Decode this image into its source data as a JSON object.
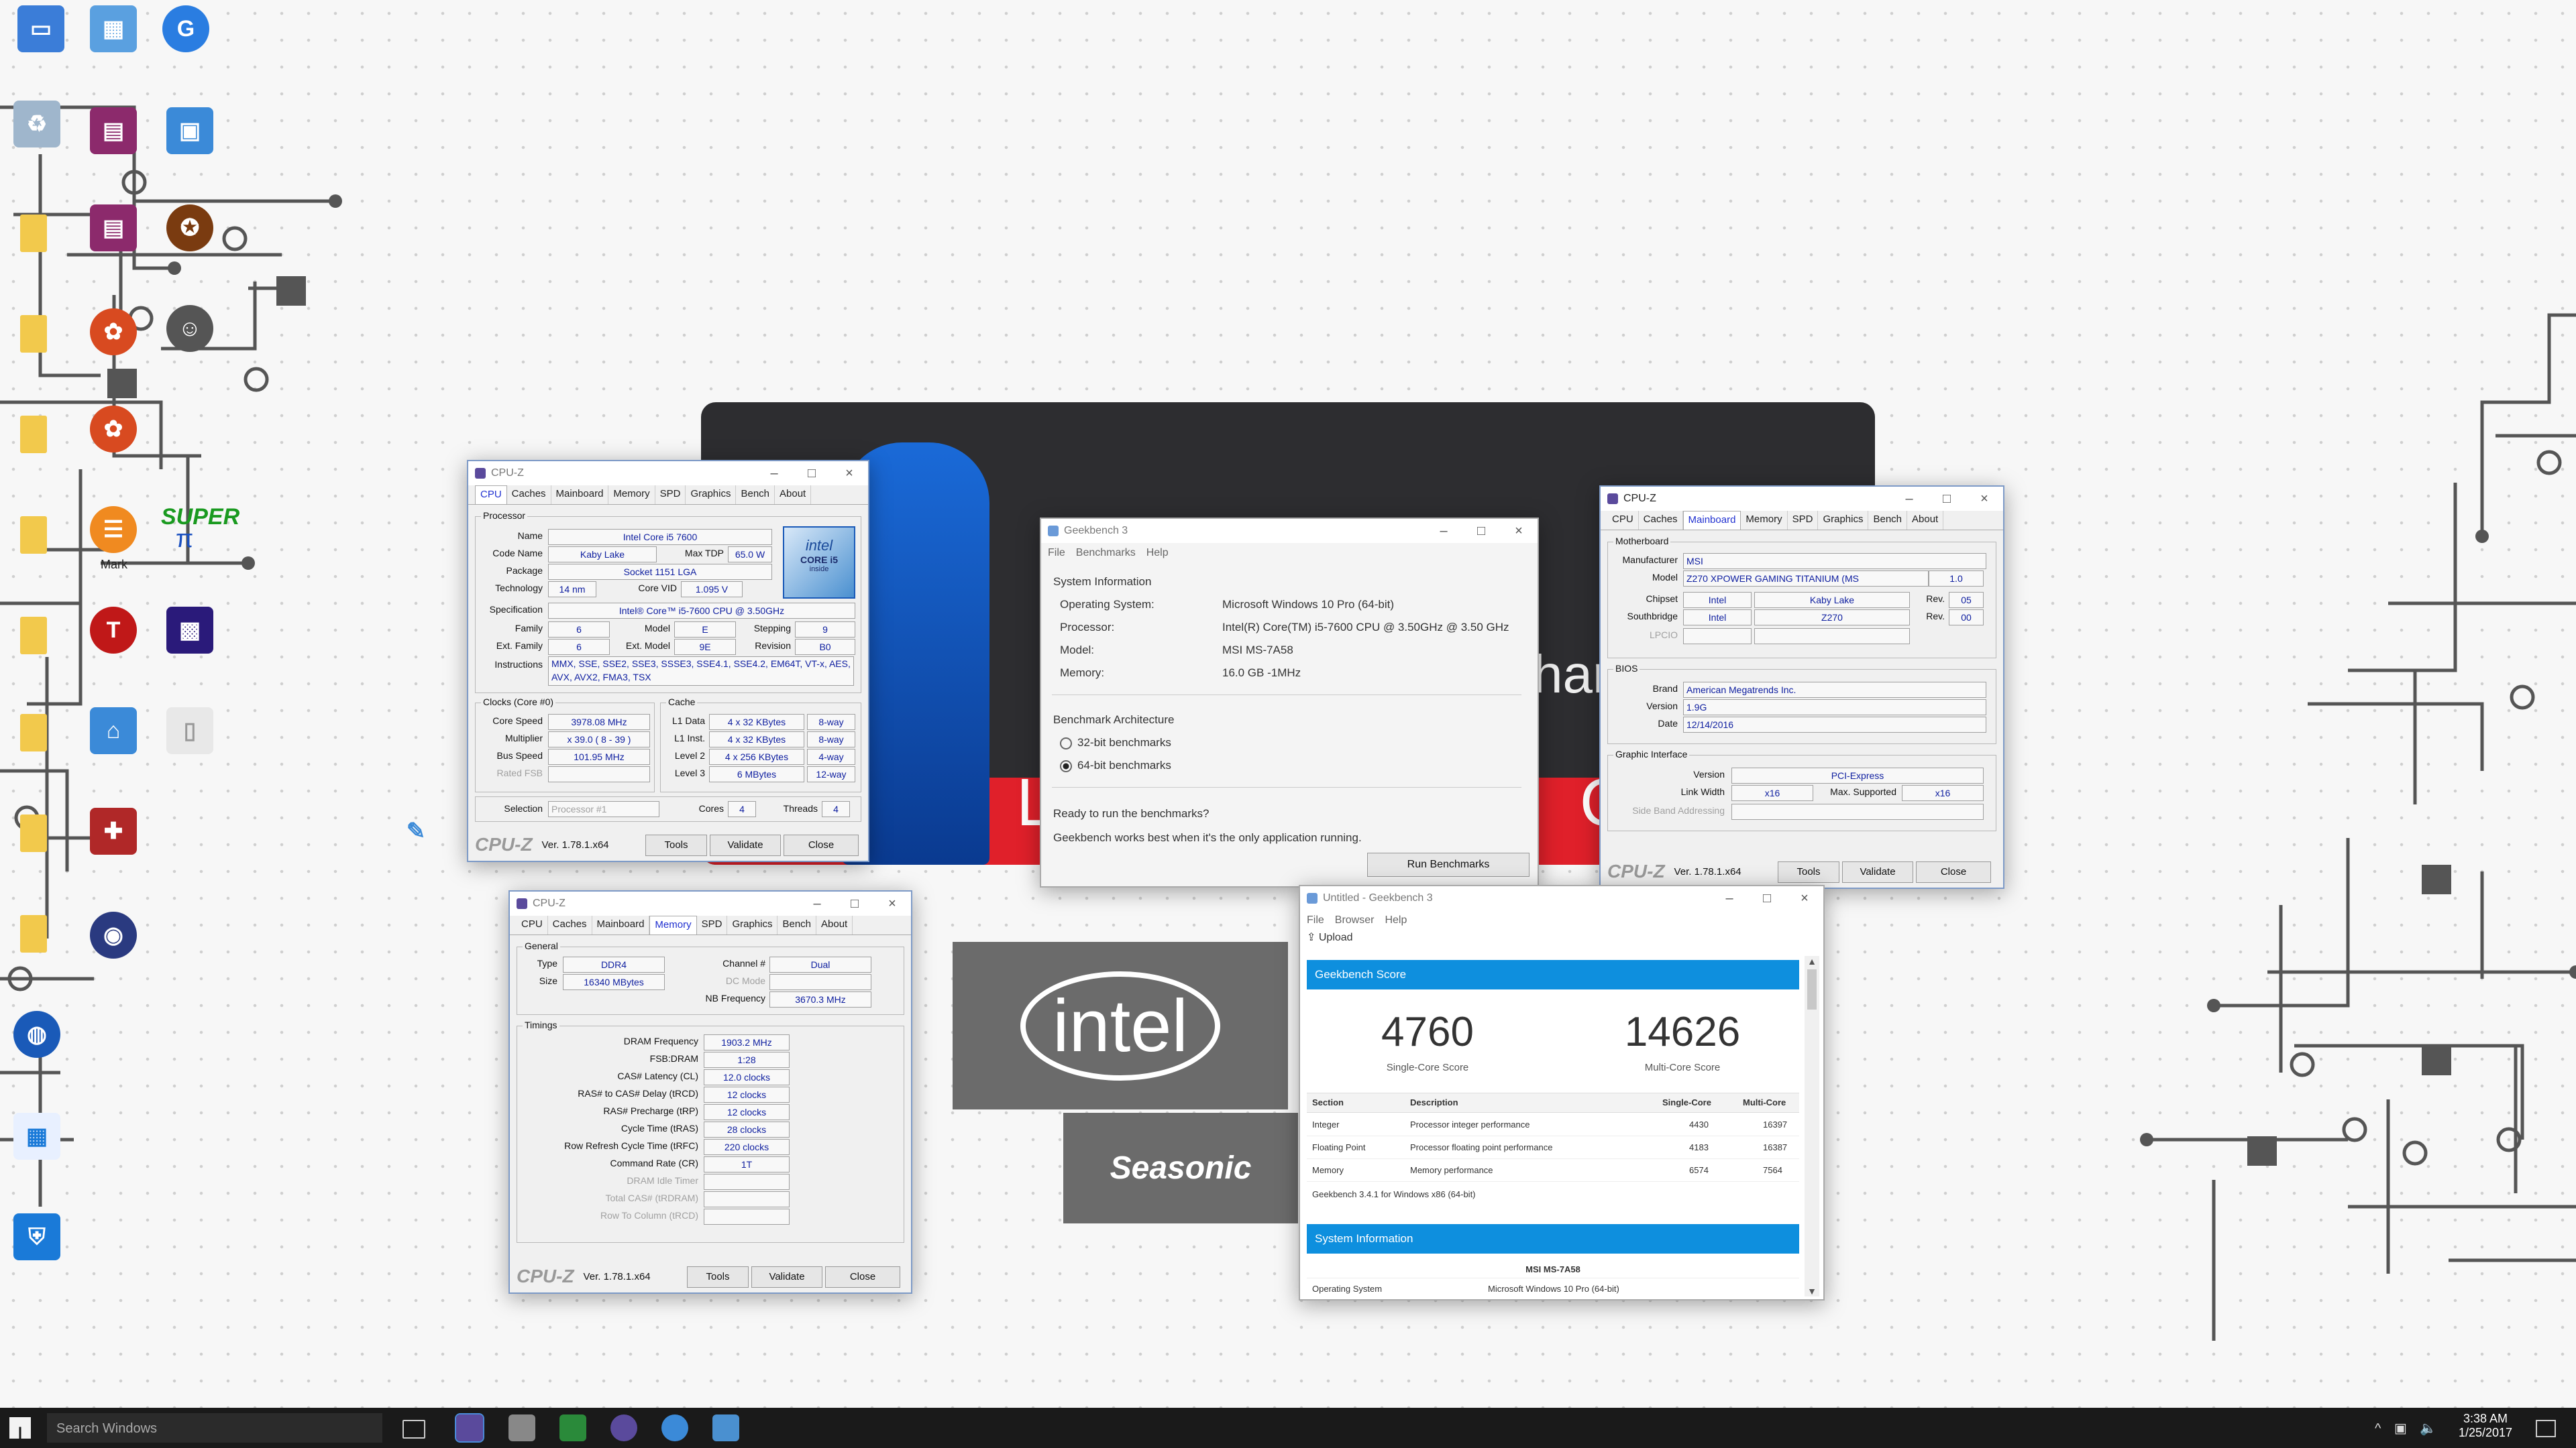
{
  "colors": {
    "accent": "#0e8fde",
    "cpuz_blue": "#2030d0",
    "banner_red": "#e0202a",
    "banner_dark": "#2d2d30"
  },
  "desktop": {
    "icons": [
      "computer-icon",
      "control-panel-icon",
      "google-chrome-icon",
      "recycle-bin-icon",
      "winrar-icon",
      "windows-update-icon",
      "game-icon",
      "super-pi-icon",
      "cinebench-icon",
      "cpu-icon",
      "intel-icon"
    ],
    "label_mark": "Mark",
    "label_super": "SUPER",
    "label_pi": "π"
  },
  "banner": {
    "letters_left": "L",
    "letters_right": "Q",
    "partial": "har"
  },
  "intel_logo": "intel",
  "seasonic_logo": "Seasonic",
  "cpuz_cpu": {
    "title": "CPU-Z",
    "tabs": [
      "CPU",
      "Caches",
      "Mainboard",
      "Memory",
      "SPD",
      "Graphics",
      "Bench",
      "About"
    ],
    "processor_group": "Processor",
    "name_label": "Name",
    "name": "Intel Core i5 7600",
    "codename_label": "Code Name",
    "codename": "Kaby Lake",
    "maxtdp_label": "Max TDP",
    "maxtdp": "65.0 W",
    "package_label": "Package",
    "package": "Socket 1151 LGA",
    "technology_label": "Technology",
    "technology": "14 nm",
    "corevid_label": "Core VID",
    "corevid": "1.095 V",
    "spec_label": "Specification",
    "spec": "Intel® Core™ i5-7600 CPU @ 3.50GHz",
    "family_label": "Family",
    "family": "6",
    "model_label": "Model",
    "model": "E",
    "stepping_label": "Stepping",
    "stepping": "9",
    "extfamily_label": "Ext. Family",
    "extfamily": "6",
    "extmodel_label": "Ext. Model",
    "extmodel": "9E",
    "revision_label": "Revision",
    "revision": "B0",
    "instr_label": "Instructions",
    "instr": "MMX, SSE, SSE2, SSE3, SSSE3, SSE4.1, SSE4.2, EM64T, VT-x, AES, AVX, AVX2, FMA3, TSX",
    "clocks_group": "Clocks (Core #0)",
    "corespeed_label": "Core Speed",
    "corespeed": "3978.08 MHz",
    "multiplier_label": "Multiplier",
    "multiplier": "x 39.0 ( 8 - 39 )",
    "busspeed_label": "Bus Speed",
    "busspeed": "101.95 MHz",
    "ratedfsb_label": "Rated FSB",
    "cache_group": "Cache",
    "l1d_label": "L1 Data",
    "l1d": "4 x 32 KBytes",
    "l1d_way": "8-way",
    "l1i_label": "L1 Inst.",
    "l1i": "4 x 32 KBytes",
    "l1i_way": "8-way",
    "l2_label": "Level 2",
    "l2": "4 x 256 KBytes",
    "l2_way": "4-way",
    "l3_label": "Level 3",
    "l3": "6 MBytes",
    "l3_way": "12-way",
    "selection_label": "Selection",
    "selection": "Processor #1",
    "cores_label": "Cores",
    "cores": "4",
    "threads_label": "Threads",
    "threads": "4",
    "intel_badge_top": "intel",
    "intel_badge_mid": "CORE i5",
    "intel_badge_bot": "inside"
  },
  "cpuz_footer": {
    "logo": "CPU-Z",
    "version": "Ver. 1.78.1.x64",
    "tools": "Tools",
    "validate": "Validate",
    "close": "Close"
  },
  "cpuz_mem": {
    "title": "CPU-Z",
    "general_group": "General",
    "type_label": "Type",
    "type": "DDR4",
    "channel_label": "Channel #",
    "channel": "Dual",
    "size_label": "Size",
    "size": "16340 MBytes",
    "dcmode_label": "DC Mode",
    "nbfreq_label": "NB Frequency",
    "nbfreq": "3670.3 MHz",
    "timings_group": "Timings",
    "dram_label": "DRAM Frequency",
    "dram": "1903.2 MHz",
    "fsb_label": "FSB:DRAM",
    "fsb": "1:28",
    "cl_label": "CAS# Latency (CL)",
    "cl": "12.0 clocks",
    "trcd_label": "RAS# to CAS# Delay (tRCD)",
    "trcd": "12 clocks",
    "trp_label": "RAS# Precharge (tRP)",
    "trp": "12 clocks",
    "tras_label": "Cycle Time (tRAS)",
    "tras": "28 clocks",
    "trfc_label": "Row Refresh Cycle Time (tRFC)",
    "trfc": "220 clocks",
    "cr_label": "Command Rate (CR)",
    "cr": "1T",
    "idle_label": "DRAM Idle Timer",
    "totalcas_label": "Total CAS# (tRDRAM)",
    "rowcol_label": "Row To Column (tRCD)"
  },
  "cpuz_mb": {
    "title": "CPU-Z",
    "motherboard_group": "Motherboard",
    "manufacturer_label": "Manufacturer",
    "manufacturer": "MSI",
    "model_label": "Model",
    "model": "Z270 XPOWER GAMING TITANIUM (MS",
    "model_rev": "1.0",
    "chipset_label": "Chipset",
    "chipset_vendor": "Intel",
    "chipset_name": "Kaby Lake",
    "chipset_rev_label": "Rev.",
    "chipset_rev": "05",
    "south_label": "Southbridge",
    "south_vendor": "Intel",
    "south_name": "Z270",
    "south_rev_label": "Rev.",
    "south_rev": "00",
    "lpcio_label": "LPCIO",
    "bios_group": "BIOS",
    "brand_label": "Brand",
    "brand": "American Megatrends Inc.",
    "version_label": "Version",
    "version": "1.9G",
    "date_label": "Date",
    "date": "12/14/2016",
    "gi_group": "Graphic Interface",
    "gi_version_label": "Version",
    "gi_version": "PCI-Express",
    "linkwidth_label": "Link Width",
    "linkwidth": "x16",
    "maxsup_label": "Max. Supported",
    "maxsup": "x16",
    "sideband_label": "Side Band Addressing"
  },
  "gb_launcher": {
    "title": "Geekbench 3",
    "menu": [
      "File",
      "Benchmarks",
      "Help"
    ],
    "sysinfo_heading": "System Information",
    "os_label": "Operating System:",
    "os": "Microsoft Windows 10 Pro (64-bit)",
    "proc_label": "Processor:",
    "proc": "Intel(R) Core(TM) i5-7600 CPU @ 3.50GHz @ 3.50 GHz",
    "model_label": "Model:",
    "model": "MSI MS-7A58",
    "mem_label": "Memory:",
    "mem": "16.0 GB -1MHz",
    "arch_heading": "Benchmark Architecture",
    "opt32": "32-bit benchmarks",
    "opt64": "64-bit benchmarks",
    "ready": "Ready to run the benchmarks?",
    "hint": "Geekbench works best when it's the only application running.",
    "run_button": "Run Benchmarks"
  },
  "gb_results": {
    "title": "Untitled - Geekbench 3",
    "menu": [
      "File",
      "Browser",
      "Help"
    ],
    "upload": "Upload",
    "score_heading": "Geekbench Score",
    "single_score": "4760",
    "single_label": "Single-Core Score",
    "multi_score": "14626",
    "multi_label": "Multi-Core Score",
    "headers": [
      "Section",
      "Description",
      "Single-Core",
      "Multi-Core"
    ],
    "rows": [
      [
        "Integer",
        "Processor integer performance",
        "4430",
        "16397"
      ],
      [
        "Floating Point",
        "Processor floating point performance",
        "4183",
        "16387"
      ],
      [
        "Memory",
        "Memory performance",
        "6574",
        "7564"
      ]
    ],
    "version_note": "Geekbench 3.4.1 for Windows x86 (64-bit)",
    "sysinfo_heading": "System Information",
    "sys_model": "MSI MS-7A58",
    "os_label": "Operating System",
    "os": "Microsoft Windows 10 Pro (64-bit)"
  },
  "taskbar": {
    "search_placeholder": "Search Windows",
    "time": "3:38 AM",
    "date": "1/25/2017"
  }
}
